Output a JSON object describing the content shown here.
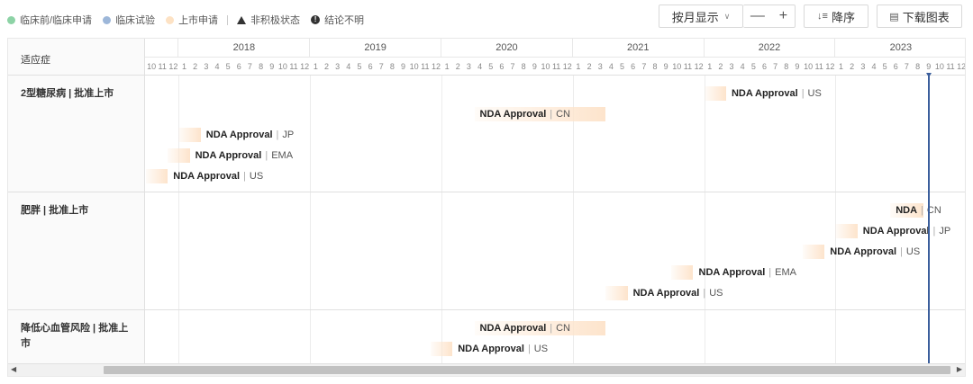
{
  "legend": [
    {
      "label": "临床前/临床申请",
      "color": "#8dd3a6",
      "shape": "dot"
    },
    {
      "label": "临床试验",
      "color": "#9db7d9",
      "shape": "dot"
    },
    {
      "label": "上市申请",
      "color": "#fde2c4",
      "shape": "dot"
    },
    {
      "label": "非积极状态",
      "color": "#333333",
      "shape": "triangle"
    },
    {
      "label": "结论不明",
      "color": "#333333",
      "shape": "exclamation"
    }
  ],
  "controls": {
    "month_view": "按月显示",
    "zoom_out": "—",
    "zoom_in": "+",
    "sort": "降序",
    "download": "下载图表"
  },
  "chart_data": {
    "type": "gantt",
    "left_header": "适应症",
    "start_date": "2017-10",
    "years": [
      "2018",
      "2019",
      "2020",
      "2021",
      "2022",
      "2023"
    ],
    "month_labels": [
      "10",
      "11",
      "12",
      "1",
      "2",
      "3",
      "4",
      "5",
      "6",
      "7",
      "8",
      "9",
      "10",
      "11",
      "12"
    ],
    "today": "2023-09",
    "colors": {
      "bar": "#fde4cc",
      "today": "#3b5e9c"
    },
    "rows": [
      {
        "label": "2型糖尿病 | 批准上市",
        "events": [
          {
            "name": "NDA Approval",
            "region": "US",
            "start": "2022-01",
            "end": "2022-03"
          },
          {
            "name": "NDA Approval",
            "region": "CN",
            "start": "2020-04",
            "end": "2021-04"
          },
          {
            "name": "NDA Approval",
            "region": "JP",
            "start": "2018-01",
            "end": "2018-03"
          },
          {
            "name": "NDA Approval",
            "region": "EMA",
            "start": "2017-12",
            "end": "2018-02"
          },
          {
            "name": "NDA Approval",
            "region": "US",
            "start": "2017-10",
            "end": "2017-12"
          }
        ]
      },
      {
        "label": "肥胖 | 批准上市",
        "events": [
          {
            "name": "NDA",
            "region": "CN",
            "start": "2023-06",
            "end": "2023-09"
          },
          {
            "name": "NDA Approval",
            "region": "JP",
            "start": "2023-01",
            "end": "2023-03"
          },
          {
            "name": "NDA Approval",
            "region": "US",
            "start": "2022-10",
            "end": "2022-12"
          },
          {
            "name": "NDA Approval",
            "region": "EMA",
            "start": "2021-10",
            "end": "2021-12"
          },
          {
            "name": "NDA Approval",
            "region": "US",
            "start": "2021-04",
            "end": "2021-06"
          }
        ]
      },
      {
        "label": "降低心血管风险 | 批准上市",
        "events": [
          {
            "name": "NDA Approval",
            "region": "CN",
            "start": "2020-04",
            "end": "2021-04"
          },
          {
            "name": "NDA Approval",
            "region": "US",
            "start": "2019-12",
            "end": "2020-02"
          }
        ]
      }
    ]
  }
}
